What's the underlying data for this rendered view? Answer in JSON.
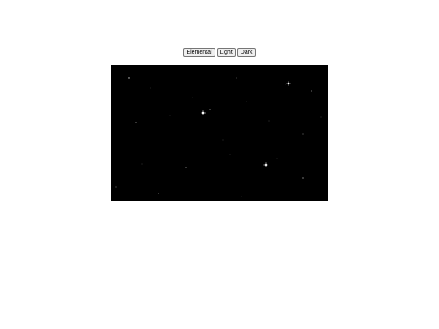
{
  "header": {
    "lines": [
      "",
      "",
      ""
    ]
  },
  "controls": {
    "elemental_label": "Elemental",
    "light_label": "Light",
    "dark_label": "Dark"
  },
  "scene": {
    "background": "#000000",
    "star_color": "#ffffff",
    "bright_star_count": 3
  }
}
